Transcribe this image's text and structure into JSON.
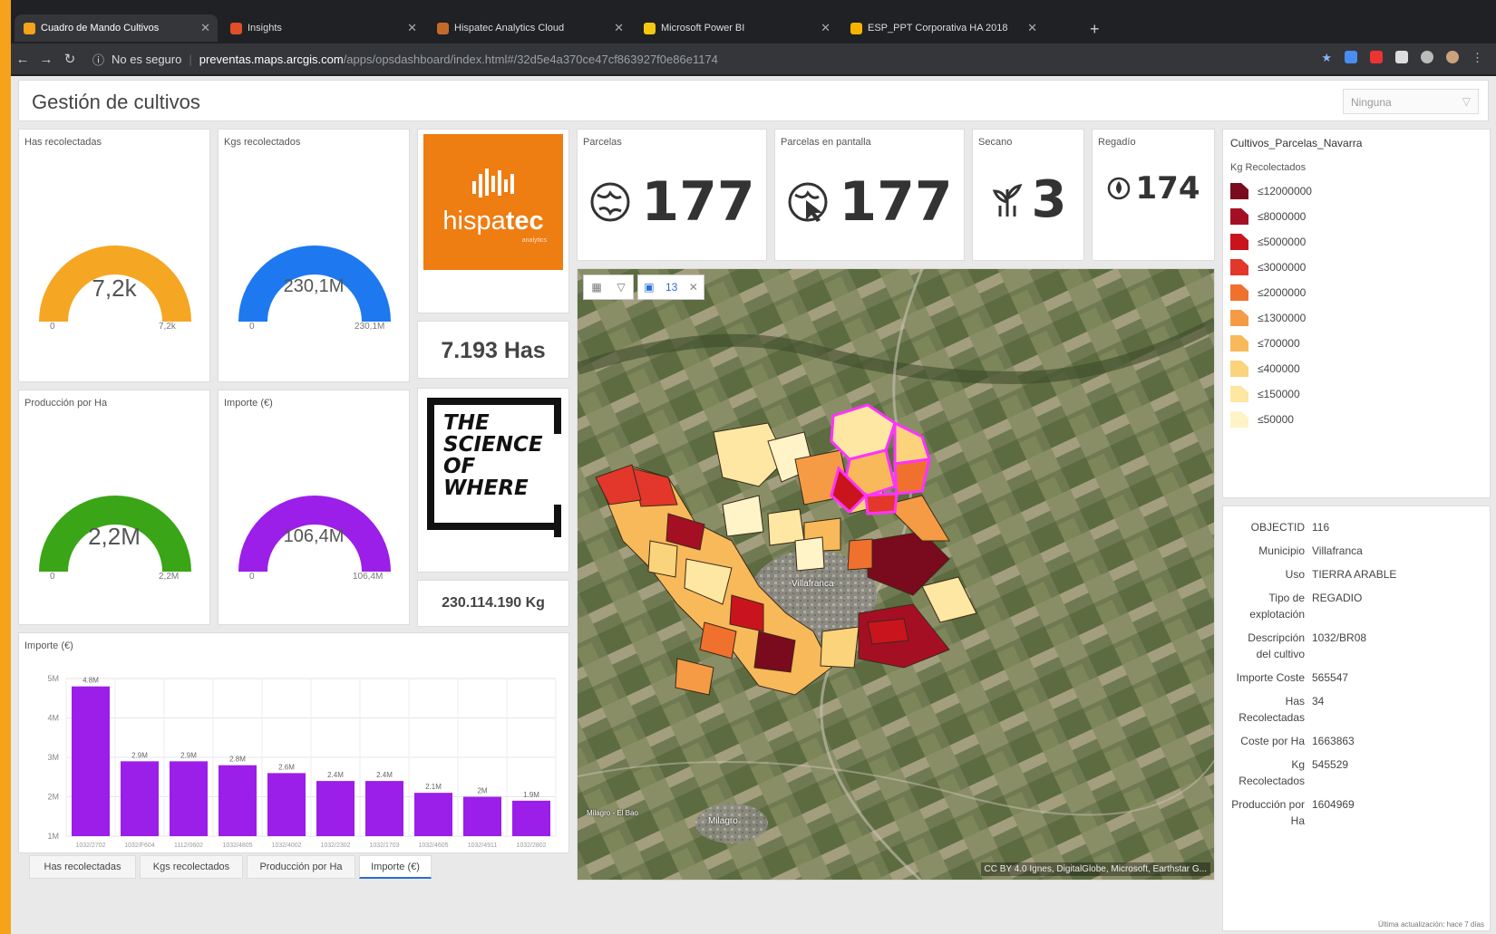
{
  "browser": {
    "tabs": [
      {
        "title": "Cuadro de Mando Cultivos",
        "favicon_color": "#f6a21a"
      },
      {
        "title": "Insights",
        "favicon_color": "#e04e2a"
      },
      {
        "title": "Hispatec Analytics Cloud",
        "favicon_color": "#c56b2a"
      },
      {
        "title": "Microsoft Power BI",
        "favicon_color": "#f2c811"
      },
      {
        "title": "ESP_PPT Corporativa HA 2018",
        "favicon_color": "#f6b400"
      }
    ],
    "security": "No es seguro",
    "url_host": "preventas.maps.arcgis.com",
    "url_path": "/apps/opsdashboard/index.html#/32d5e4a370ce47cf863927f0e86e1174"
  },
  "header": {
    "title": "Gestión de cultivos",
    "selector_value": "Ninguna"
  },
  "gauges": [
    {
      "title": "Has recolectadas",
      "value": "7,2k",
      "min": "0",
      "max": "7,2k",
      "color": "#f5a623",
      "fraction": 1.0
    },
    {
      "title": "Kgs recolectados",
      "value": "230,1M",
      "min": "0",
      "max": "230,1M",
      "color": "#1e78f0",
      "fraction": 1.0
    },
    {
      "title": "Producción por Ha",
      "value": "2,2M",
      "min": "0",
      "max": "2,2M",
      "color": "#3aa517",
      "fraction": 1.0
    },
    {
      "title": "Importe (€)",
      "value": "106,4M",
      "min": "0",
      "max": "106,4M",
      "color": "#9b1fe8",
      "fraction": 1.0
    }
  ],
  "brand": {
    "logo_text_light": "hispa",
    "logo_text_bold": "tec",
    "logo_sub": "analytics",
    "logo_bg": "#ee7d12"
  },
  "stats": {
    "has_text": "7.193 Has",
    "kg_text": "230.114.190 Kg"
  },
  "science": {
    "lines": [
      "THE",
      "SCIENCE",
      "OF",
      "WHERE"
    ]
  },
  "indicators": [
    {
      "title": "Parcelas",
      "value": "177",
      "icon": "globe-icon"
    },
    {
      "title": "Parcelas en pantalla",
      "value": "177",
      "icon": "globe-cursor-icon"
    },
    {
      "title": "Secano",
      "value": "3",
      "icon": "plant-icon"
    },
    {
      "title": "Regadío",
      "value": "174",
      "icon": "water-drop-icon"
    }
  ],
  "map": {
    "toolbar_count": "13",
    "town_label": "Villafranca",
    "town_label_2": "Milagro",
    "town_label_3": "Milagro - El Bao",
    "attribution": "CC BY 4.0 Ignes, DigitalGlobe, Microsoft, Earthstar G..."
  },
  "legend": {
    "title": "Cultivos_Parcelas_Navarra",
    "field": "Kg Recolectados",
    "items": [
      {
        "label": "≤12000000",
        "color": "#7a0a1e"
      },
      {
        "label": "≤8000000",
        "color": "#a50f24"
      },
      {
        "label": "≤5000000",
        "color": "#c9141e"
      },
      {
        "label": "≤3000000",
        "color": "#e2372a"
      },
      {
        "label": "≤2000000",
        "color": "#f0702e"
      },
      {
        "label": "≤1300000",
        "color": "#f59b45"
      },
      {
        "label": "≤700000",
        "color": "#f8b95a"
      },
      {
        "label": "≤400000",
        "color": "#fbd37b"
      },
      {
        "label": "≤150000",
        "color": "#fde7a2"
      },
      {
        "label": "≤50000",
        "color": "#fff3c8"
      }
    ]
  },
  "details": {
    "rows": [
      {
        "key": "OBJECTID",
        "value": "116"
      },
      {
        "key": "Municipio",
        "value": "Villafranca"
      },
      {
        "key": "Uso",
        "value": "TIERRA ARABLE"
      },
      {
        "key": "Tipo de explotación",
        "value": "REGADIO"
      },
      {
        "key": "Descripción del cultivo",
        "value": "1032/BR08"
      },
      {
        "key": "Importe Coste",
        "value": "565547"
      },
      {
        "key": "Has Recolectadas",
        "value": "34"
      },
      {
        "key": "Coste por Ha",
        "value": "1663863"
      },
      {
        "key": "Kg Recolectados",
        "value": "545529"
      },
      {
        "key": "Producción por Ha",
        "value": "1604969"
      }
    ],
    "footer": "Última actualización: hace 7 días"
  },
  "bottom_tabs": [
    "Has recolectadas",
    "Kgs recolectados",
    "Producción por Ha",
    "Importe (€)"
  ],
  "chart_data": {
    "type": "bar",
    "title": "Importe (€)",
    "categories": [
      "1032/2702",
      "1032/F604",
      "1112/0602",
      "1032/4805",
      "1032/4002",
      "1032/2302",
      "1032/1703",
      "1032/4605",
      "1032/4911",
      "1032/2802"
    ],
    "values": [
      4.8,
      2.9,
      2.9,
      2.8,
      2.6,
      2.4,
      2.4,
      2.1,
      2.0,
      1.9
    ],
    "data_labels": [
      "4.8M",
      "2.9M",
      "2.9M",
      "2.8M",
      "2.6M",
      "2.4M",
      "2.4M",
      "2.1M",
      "2M",
      "1.9M"
    ],
    "y_ticks": [
      "1M",
      "2M",
      "3M",
      "4M",
      "5M"
    ],
    "ylim": [
      1,
      5
    ],
    "bar_color": "#9b1fe8",
    "grid": true
  }
}
